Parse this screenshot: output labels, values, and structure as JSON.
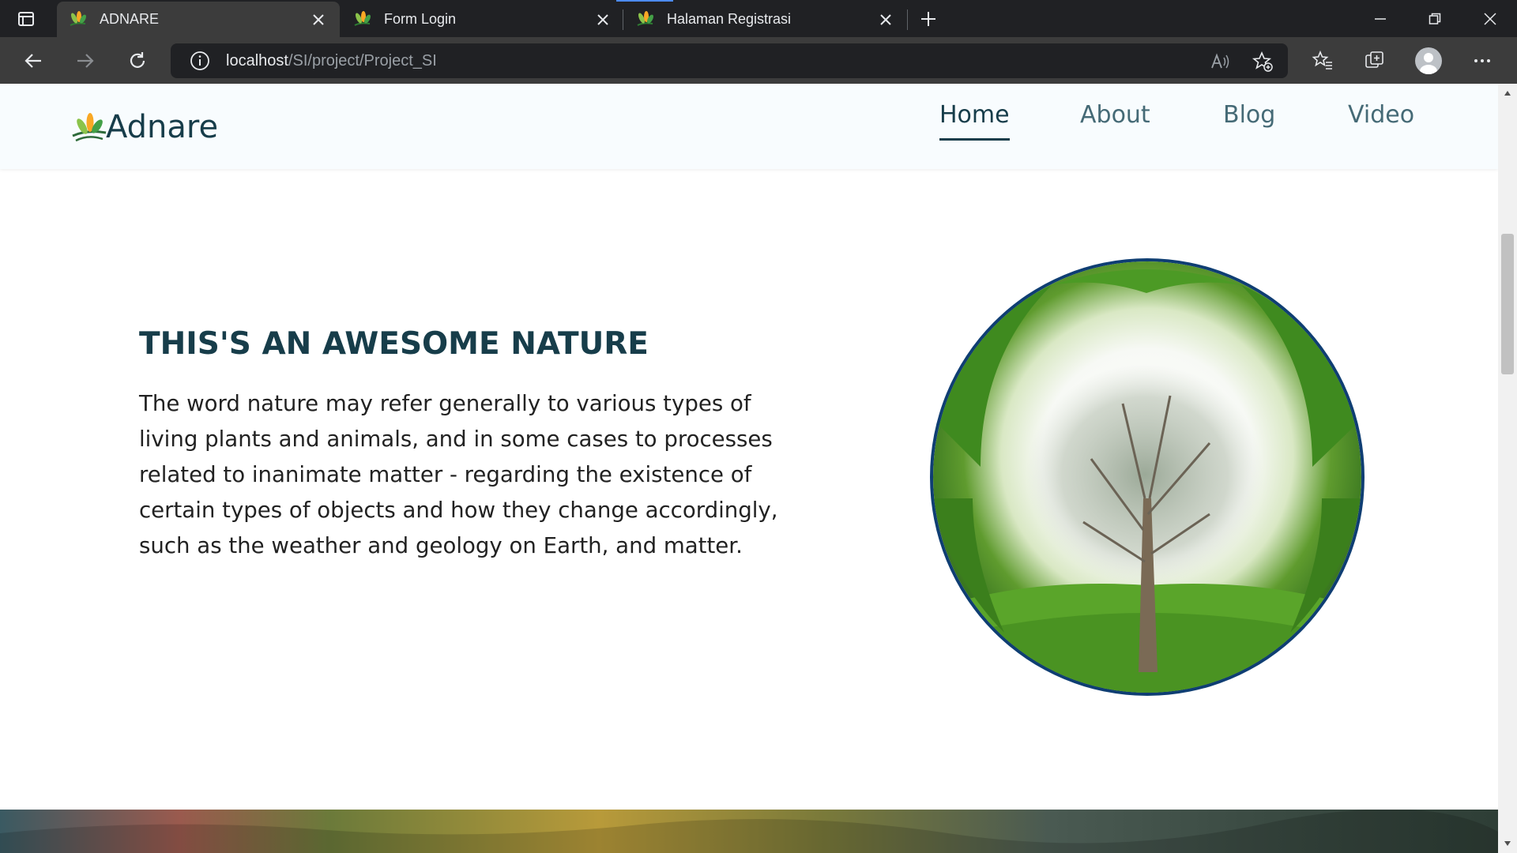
{
  "browser": {
    "tabs": [
      {
        "title": "ADNARE",
        "active": true
      },
      {
        "title": "Form Login",
        "active": false
      },
      {
        "title": "Halaman Registrasi",
        "active": false
      }
    ],
    "url": {
      "host": "localhost",
      "path": "/SI/project/Project_SI"
    },
    "icons": [
      "tab-strip-icon",
      "close-icon",
      "new-tab-icon",
      "minimize-icon",
      "restore-icon",
      "window-close-icon",
      "back-icon",
      "forward-icon",
      "refresh-icon",
      "info-icon",
      "read-aloud-icon",
      "add-favorite-icon",
      "favorites-icon",
      "collections-icon",
      "profile-avatar",
      "more-menu-icon"
    ]
  },
  "site": {
    "brand": "Adnare",
    "nav": [
      {
        "label": "Home",
        "active": true
      },
      {
        "label": "About",
        "active": false
      },
      {
        "label": "Blog",
        "active": false
      },
      {
        "label": "Video",
        "active": false
      }
    ],
    "hero": {
      "title": "THIS'S AN AWESOME NATURE",
      "text": "The word nature may refer generally to various types of living plants and animals, and in some cases to processes related to inanimate matter - regarding the existence of certain types of objects and how they change accordingly, such as the weather and geology on Earth, and matter."
    }
  },
  "colors": {
    "brand_dark": "#173d4a",
    "nav_link": "#456a76",
    "circle_border": "#0f3e73",
    "tabbar": "#202124",
    "toolbar": "#3c3c3c"
  }
}
